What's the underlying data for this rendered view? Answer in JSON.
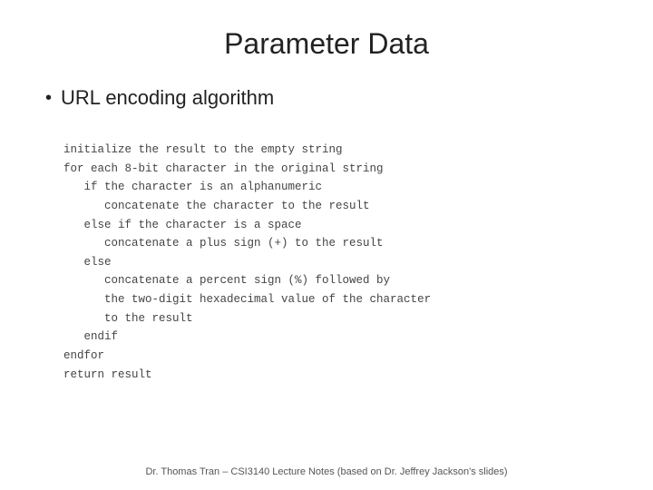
{
  "slide": {
    "title": "Parameter Data",
    "bullet": {
      "dot": "•",
      "text": "URL encoding algorithm"
    },
    "code": {
      "lines": [
        "initialize the result to the empty string",
        "for each 8-bit character in the original string",
        "   if the character is an alphanumeric",
        "      concatenate the character to the result",
        "   else if the character is a space",
        "      concatenate a plus sign (+) to the result",
        "   else",
        "      concatenate a percent sign (%) followed by",
        "      the two-digit hexadecimal value of the character",
        "      to the result",
        "   endif",
        "endfor",
        "return result"
      ]
    },
    "footer": "Dr. Thomas Tran – CSI3140 Lecture Notes (based on Dr. Jeffrey Jackson's slides)"
  }
}
